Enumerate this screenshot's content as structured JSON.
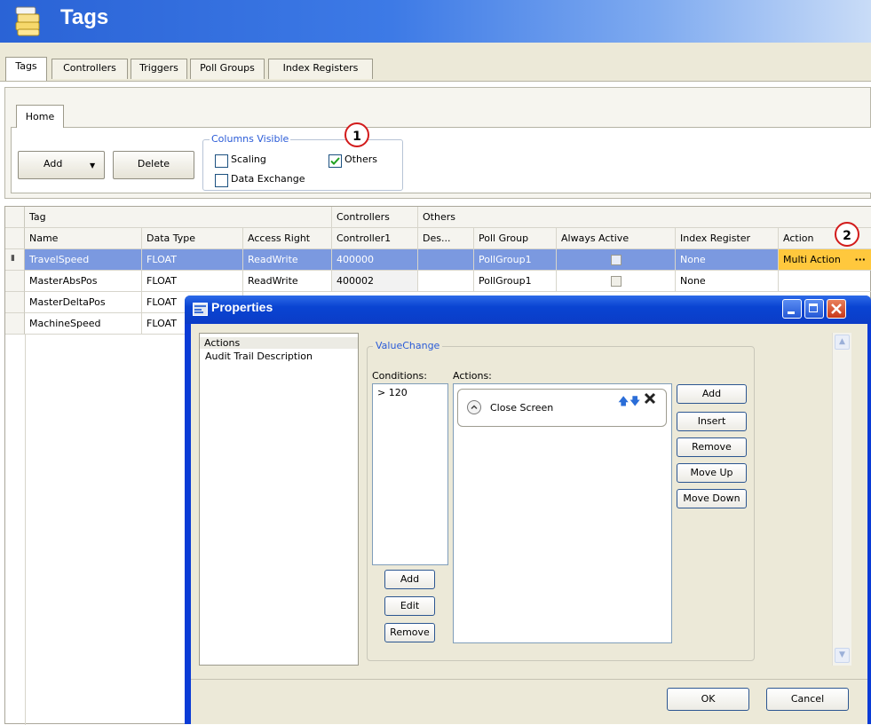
{
  "app": {
    "title": "Tags"
  },
  "main_tabs": [
    "Tags",
    "Controllers",
    "Triggers",
    "Poll Groups",
    "Index Registers"
  ],
  "ribbon": {
    "tab": "Home",
    "add_label": "Add",
    "delete_label": "Delete",
    "columns_visible": {
      "legend": "Columns Visible",
      "scaling": {
        "label": "Scaling",
        "checked": false
      },
      "others": {
        "label": "Others",
        "checked": true
      },
      "data_exchange": {
        "label": "Data Exchange",
        "checked": false
      }
    }
  },
  "callouts": [
    "1",
    "2"
  ],
  "grid": {
    "groups": [
      "Tag",
      "Controllers",
      "Others"
    ],
    "columns": [
      "Name",
      "Data Type",
      "Access Right",
      "Controller1",
      "Des...",
      "Poll Group",
      "Always Active",
      "Index Register",
      "Action"
    ],
    "rows": [
      {
        "name": "TravelSpeed",
        "type": "FLOAT",
        "access": "ReadWrite",
        "controller": "400000",
        "desc": "",
        "poll": "PollGroup1",
        "always_active": false,
        "index": "None",
        "action": "Multi Action",
        "action_button": "···"
      },
      {
        "name": "MasterAbsPos",
        "type": "FLOAT",
        "access": "ReadWrite",
        "controller": "400002",
        "desc": "",
        "poll": "PollGroup1",
        "always_active": false,
        "index": "None",
        "action": ""
      },
      {
        "name": "MasterDeltaPos",
        "type": "FLOAT"
      },
      {
        "name": "MachineSpeed",
        "type": "FLOAT"
      }
    ]
  },
  "dialog": {
    "title": "Properties",
    "nav": [
      "Actions",
      "Audit Trail Description"
    ],
    "group_title": "ValueChange",
    "conditions_label": "Conditions:",
    "actions_label": "Actions:",
    "conditions": [
      "> 120"
    ],
    "action_items": [
      "Close Screen"
    ],
    "condition_buttons": [
      "Add",
      "Edit",
      "Remove"
    ],
    "action_buttons": [
      "Add",
      "Insert",
      "Remove",
      "Move Up",
      "Move Down"
    ],
    "ok_label": "OK",
    "cancel_label": "Cancel"
  }
}
